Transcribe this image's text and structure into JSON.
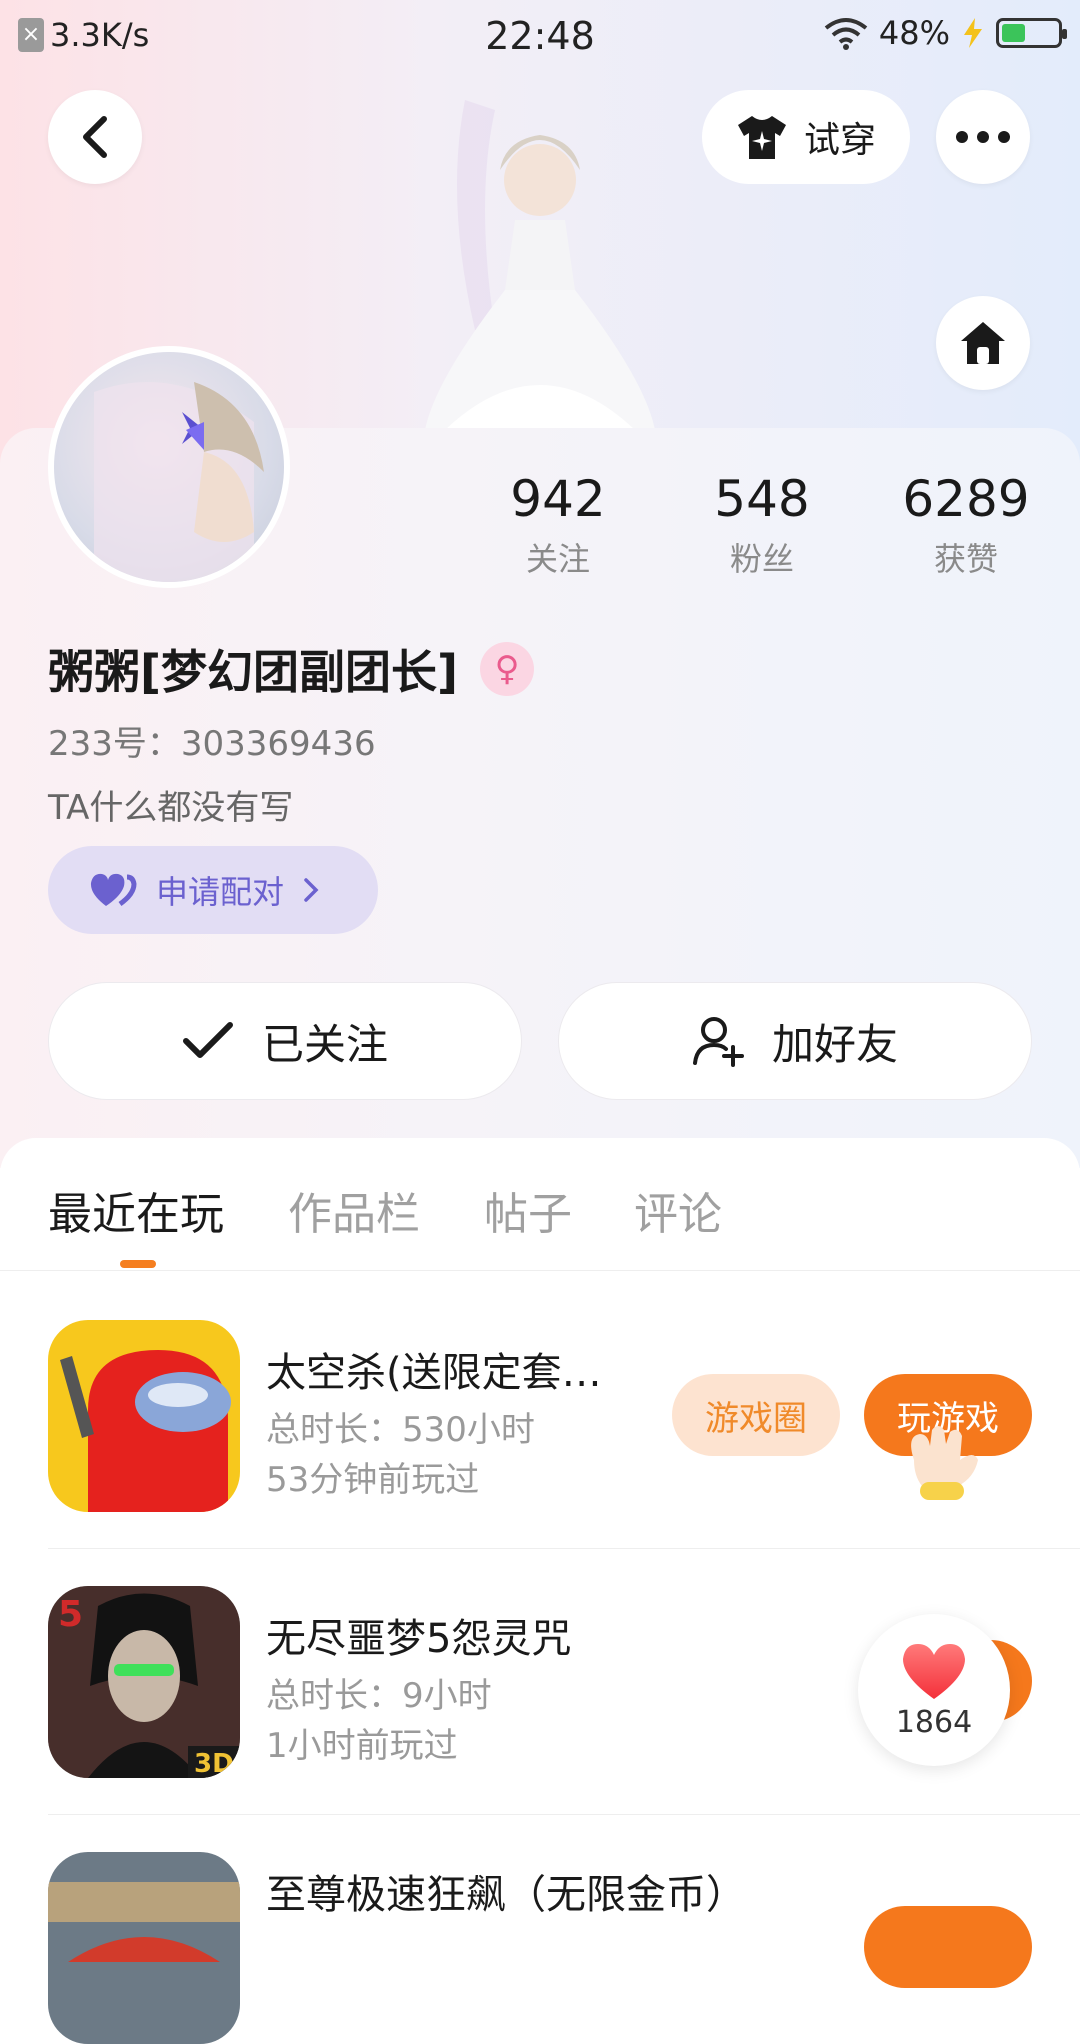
{
  "status_bar": {
    "net_speed": "3.3K/s",
    "time": "22:48",
    "battery_text": "48%",
    "battery_level": 0.48
  },
  "header": {
    "try_on_label": "试穿"
  },
  "profile": {
    "stats": [
      {
        "value": "942",
        "label": "关注"
      },
      {
        "value": "548",
        "label": "粉丝"
      },
      {
        "value": "6289",
        "label": "获赞"
      }
    ],
    "name": "粥粥[梦幻团副团长]",
    "uid": "233号：303369436",
    "bio": "TA什么都没有写",
    "pair_label": "申请配对",
    "followed_label": "已关注",
    "add_friend_label": "加好友"
  },
  "tabs": [
    "最近在玩",
    "作品栏",
    "帖子",
    "评论"
  ],
  "games": [
    {
      "title": "太空杀(送限定套…",
      "total_time": "总时长：530小时",
      "last_played": "53分钟前玩过",
      "circle_label": "游戏圈",
      "play_label": "玩游戏"
    },
    {
      "title": "无尽噩梦5怨灵咒",
      "total_time": "总时长：9小时",
      "last_played": "1小时前玩过"
    },
    {
      "title": "至尊极速狂飙（无限金币）"
    }
  ],
  "like_float": {
    "count": "1864"
  },
  "colors": {
    "accent_orange": "#f5781c",
    "pair_purple": "#6b61cf",
    "gender_pink": "#ea5b8d"
  }
}
